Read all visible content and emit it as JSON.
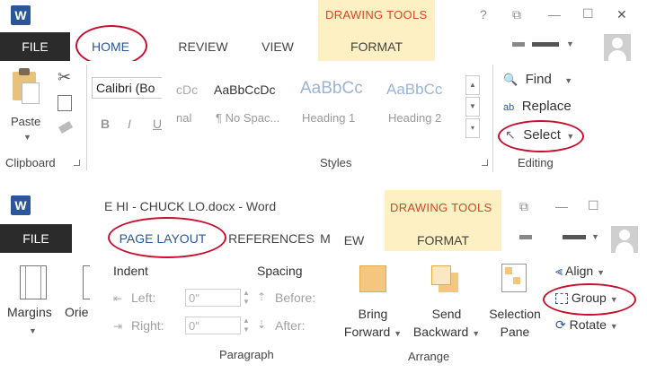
{
  "common": {
    "file_tab": "FILE",
    "drawing_tools": "DRAWING TOOLS",
    "word_icon_letter": "W"
  },
  "panel1": {
    "home_tab": "HOME"
  },
  "panel2": {
    "tabs": {
      "review": "REVIEW",
      "view": "VIEW",
      "format": "FORMAT"
    },
    "window_controls": {
      "help": "?",
      "restore": "⧉",
      "minimize": "—",
      "maximize": "☐",
      "close": "✕"
    }
  },
  "panel3": {
    "font_name": "Calibri (Bo",
    "paste_label": "Paste",
    "clipboard_label": "Clipboard",
    "bold": "B",
    "italic": "I",
    "underline": "U"
  },
  "panel4": {
    "styles": [
      {
        "preview": "cDc",
        "name": "nal"
      },
      {
        "preview": "AaBbCcDc",
        "name": "¶ No Spac..."
      },
      {
        "preview": "AaBbCc",
        "name": "Heading 1"
      },
      {
        "preview": "AaBbCc",
        "name": "Heading 2"
      }
    ],
    "styles_group_label": "Styles",
    "find_label": "Find",
    "replace_label": "Replace",
    "select_label": "Select",
    "editing_group_label": "Editing"
  },
  "panel5": {
    "margins_label": "Margins",
    "orientation_label": "Orie"
  },
  "panel6": {
    "title": "E HI - CHUCK LO.docx - Word",
    "tabs": {
      "page_layout": "PAGE LAYOUT",
      "references": "REFERENCES",
      "m": "M"
    },
    "indent_label": "Indent",
    "spacing_label": "Spacing",
    "left_label": "Left:",
    "right_label": "Right:",
    "before_label": "Before:",
    "after_label": "After:",
    "left_value": "0\"",
    "right_value": "0\"",
    "paragraph_group_label": "Paragraph"
  },
  "panel7": {
    "tabs": {
      "ew": "EW",
      "format": "FORMAT"
    },
    "bring_forward_line1": "Bring",
    "bring_forward_line2": "Forward",
    "send_backward_line1": "Send",
    "send_backward_line2": "Backward",
    "selection_pane_line1": "Selection",
    "selection_pane_line2": "Pane",
    "align_label": "Align",
    "group_label": "Group",
    "rotate_label": "Rotate",
    "arrange_group_label": "Arrange",
    "window_controls": {
      "restore": "⧉",
      "minimize": "—",
      "maximize": "☐"
    }
  },
  "colors": {
    "file_tab_bg": "#2b2b2b",
    "word_blue": "#2b579a",
    "drawing_tools_text": "#d24726",
    "drawing_tools_bg": "#fdf0c2",
    "highlight_circle": "#c8102e"
  }
}
